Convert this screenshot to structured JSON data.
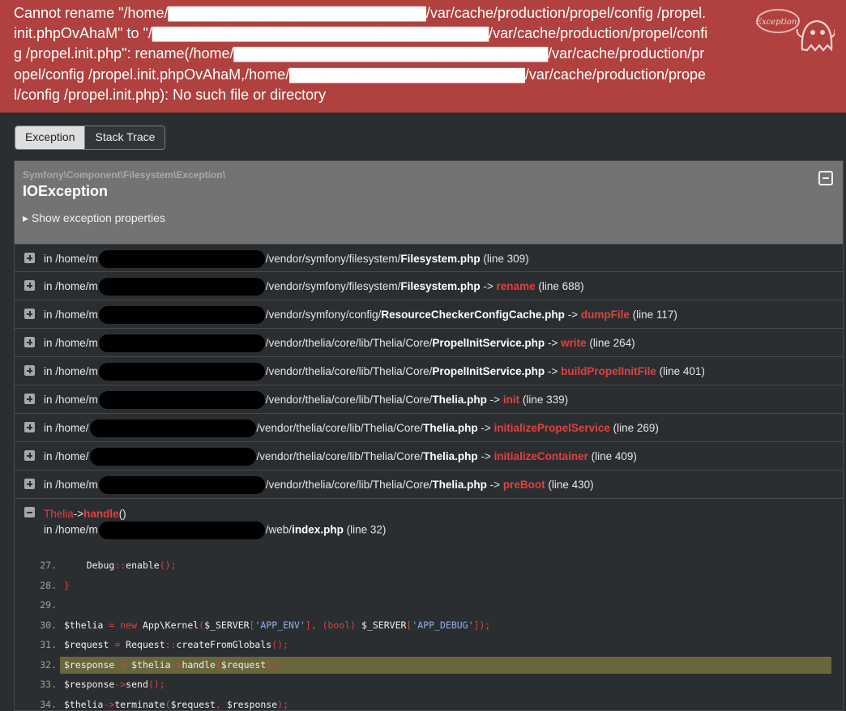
{
  "header": {
    "message": "Cannot rename \"/home/▇▇▇▇▇▇▇▇▇▇▇▇▇▇▇▇▇▇▇▇▇▇▇/var/cache/production/propel/config /propel.init.phpOvAhaM\" to \"/▇▇▇▇▇▇▇▇▇▇▇▇▇▇▇▇▇▇▇▇▇▇▇▇▇▇▇▇▇▇/var/cache/production/propel/config /propel.init.php\": rename(/home/▇▇▇▇▇▇▇▇▇▇▇▇▇▇▇▇▇▇▇▇▇▇▇▇▇▇▇▇/var/cache/production/propel/config /propel.init.phpOvAhaM,/home/▇▇▇▇▇▇▇▇▇▇▇▇▇▇▇▇▇▇▇▇▇/var/cache/production/propel/config /propel.init.php): No such file or directory",
    "badge": "Exception!"
  },
  "tabs": [
    {
      "label": "Exception"
    },
    {
      "label": "Stack Trace"
    }
  ],
  "exception": {
    "namespace": "Symfony\\Component\\Filesystem\\Exception\\",
    "class": "IOException",
    "toggle": "▸ Show exception properties"
  },
  "trace": [
    {
      "in": "in /home/m",
      "path": "/vendor/symfony/filesystem/",
      "file": "Filesystem.php",
      "func": "",
      "line": "(line 309)"
    },
    {
      "in": "in /home/m",
      "path": "/vendor/symfony/filesystem/",
      "file": "Filesystem.php",
      "func": "rename",
      "line": "(line 688)"
    },
    {
      "in": "in /home/m",
      "path": "/vendor/symfony/config/",
      "file": "ResourceCheckerConfigCache.php",
      "func": "dumpFile",
      "line": "(line 117)"
    },
    {
      "in": "in /home/m",
      "path": "/vendor/thelia/core/lib/Thelia/Core/",
      "file": "PropelInitService.php",
      "func": "write",
      "line": "(line 264)"
    },
    {
      "in": "in /home/m",
      "path": "/vendor/thelia/core/lib/Thelia/Core/",
      "file": "PropelInitService.php",
      "func": "buildPropelInitFile",
      "line": "(line 401)"
    },
    {
      "in": "in /home/m",
      "path": "/vendor/thelia/core/lib/Thelia/Core/",
      "file": "Thelia.php",
      "func": "init",
      "line": "(line 339)"
    },
    {
      "in": "in /home/",
      "path": "/vendor/thelia/core/lib/Thelia/Core/",
      "file": "Thelia.php",
      "func": "initializePropelService",
      "line": "(line 269)"
    },
    {
      "in": "in /home/",
      "path": "/vendor/thelia/core/lib/Thelia/Core/",
      "file": "Thelia.php",
      "func": "initializeContainer",
      "line": "(line 409)"
    },
    {
      "in": "in /home/m",
      "path": "/vendor/thelia/core/lib/Thelia/Core/",
      "file": "Thelia.php",
      "func": "preBoot",
      "line": "(line 430)"
    }
  ],
  "expanded": {
    "class": "Thelia",
    "arrow": "->",
    "func": "handle",
    "args": "()",
    "in": "in /home/m",
    "path": "/web/",
    "file": "index.php",
    "line": "(line 32)"
  },
  "arrow": "->",
  "code": [
    {
      "n": "27.",
      "parts": [
        [
          "t",
          "    Debug"
        ],
        [
          "k",
          "::"
        ],
        [
          "t",
          "enable"
        ],
        [
          "k",
          "();"
        ]
      ]
    },
    {
      "n": "28.",
      "parts": [
        [
          "k",
          "}"
        ]
      ]
    },
    {
      "n": "29.",
      "parts": []
    },
    {
      "n": "30.",
      "parts": [
        [
          "t",
          "$thelia "
        ],
        [
          "k",
          "="
        ],
        [
          "t",
          " "
        ],
        [
          "k",
          "new"
        ],
        [
          "t",
          " App\\Kernel"
        ],
        [
          "k",
          "("
        ],
        [
          "t",
          "$_SERVER"
        ],
        [
          "k",
          "["
        ],
        [
          "s",
          "'APP_ENV'"
        ],
        [
          "k",
          "], (bool)"
        ],
        [
          "t",
          " $_SERVER"
        ],
        [
          "k",
          "["
        ],
        [
          "s",
          "'APP_DEBUG'"
        ],
        [
          "k",
          "]);"
        ]
      ]
    },
    {
      "n": "31.",
      "parts": [
        [
          "t",
          "$request "
        ],
        [
          "k",
          "="
        ],
        [
          "t",
          " Request"
        ],
        [
          "k",
          "::"
        ],
        [
          "t",
          "createFromGlobals"
        ],
        [
          "k",
          "();"
        ]
      ]
    },
    {
      "n": "32.",
      "hl": true,
      "parts": [
        [
          "t",
          "$response "
        ],
        [
          "k",
          "="
        ],
        [
          "t",
          " $thelia"
        ],
        [
          "k",
          "->"
        ],
        [
          "t",
          "handle"
        ],
        [
          "k",
          "("
        ],
        [
          "t",
          "$request"
        ],
        [
          "k",
          ");"
        ]
      ]
    },
    {
      "n": "33.",
      "parts": [
        [
          "t",
          "$response"
        ],
        [
          "k",
          "->"
        ],
        [
          "t",
          "send"
        ],
        [
          "k",
          "();"
        ]
      ]
    },
    {
      "n": "34.",
      "parts": [
        [
          "t",
          "$thelia"
        ],
        [
          "k",
          "->"
        ],
        [
          "t",
          "terminate"
        ],
        [
          "k",
          "("
        ],
        [
          "t",
          "$request"
        ],
        [
          "k",
          ", "
        ],
        [
          "t",
          "$response"
        ],
        [
          "k",
          ");"
        ]
      ]
    }
  ],
  "colors": {
    "header_bg": "#b0413e",
    "accent_red": "#e0413f",
    "page_bg": "#2b2e31",
    "highlight": "#69663b"
  }
}
